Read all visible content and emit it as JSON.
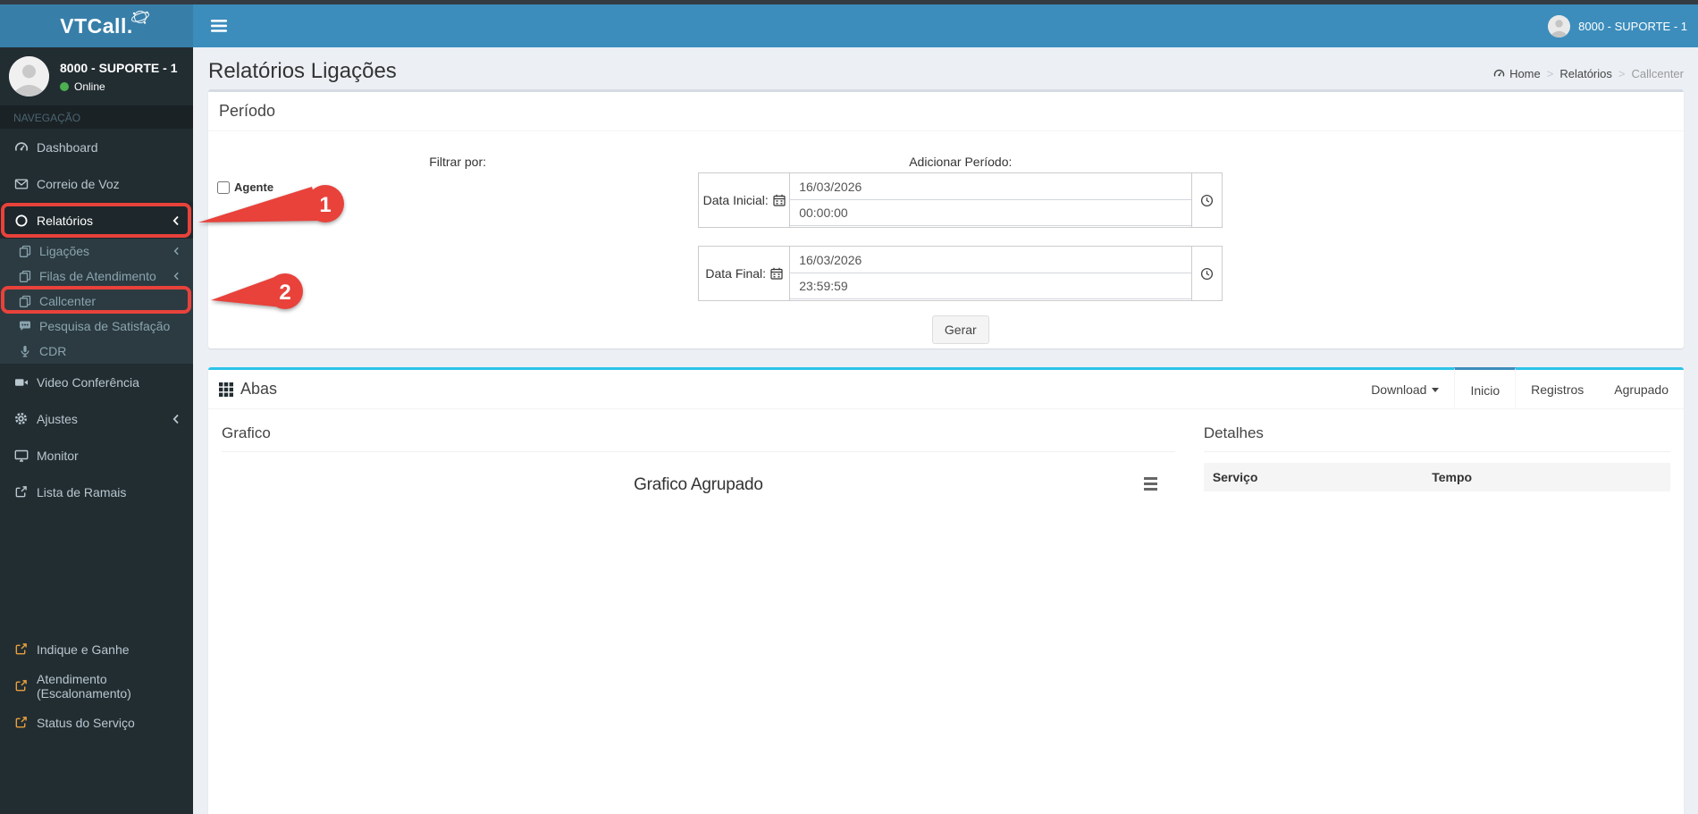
{
  "header": {
    "logo": "VTCall.",
    "user_name": "8000 - SUPORTE - 1"
  },
  "sidebar": {
    "user": {
      "name": "8000 - SUPORTE - 1",
      "status": "Online"
    },
    "nav_header": "NAVEGAÇÃO",
    "menu": [
      {
        "label": "Dashboard",
        "icon": "gauge-icon"
      },
      {
        "label": "Correio de Voz",
        "icon": "envelope-icon"
      },
      {
        "label": "Relatórios",
        "icon": "circle-icon",
        "active": true,
        "chevron": true
      }
    ],
    "submenu": [
      {
        "label": "Ligações",
        "icon": "files-icon",
        "chevron": true
      },
      {
        "label": "Filas de Atendimento",
        "icon": "files-icon",
        "chevron": true
      },
      {
        "label": "Callcenter",
        "icon": "files-icon"
      },
      {
        "label": "Pesquisa de Satisfação",
        "icon": "survey-icon"
      },
      {
        "label": "CDR",
        "icon": "microphone-icon"
      }
    ],
    "menu2": [
      {
        "label": "Video Conferência",
        "icon": "video-icon"
      },
      {
        "label": "Ajustes",
        "icon": "gear-icon",
        "chevron": true
      },
      {
        "label": "Monitor",
        "icon": "monitor-icon"
      },
      {
        "label": "Lista de Ramais",
        "icon": "external-link-icon"
      }
    ],
    "external_links": [
      {
        "label": "Indique e Ganhe",
        "icon": "external-link-icon"
      },
      {
        "label": "Atendimento (Escalonamento)",
        "icon": "external-link-icon"
      },
      {
        "label": "Status do Serviço",
        "icon": "external-link-icon"
      }
    ]
  },
  "page": {
    "title": "Relatórios Ligações",
    "breadcrumb": {
      "home": "Home",
      "section": "Relatórios",
      "current": "Callcenter"
    }
  },
  "period_panel": {
    "title": "Período",
    "filter_label": "Filtrar por:",
    "agent_label": "Agente",
    "agent_checked": false,
    "add_period_label": "Adicionar Período:",
    "date_initial": {
      "label": "Data Inicial:",
      "date": "16/03/2026",
      "time": "00:00:00"
    },
    "date_final": {
      "label": "Data Final:",
      "date": "16/03/2026",
      "time": "23:59:59"
    },
    "generate_label": "Gerar"
  },
  "tabs_panel": {
    "title": "Abas",
    "download_label": "Download",
    "tabs": [
      {
        "label": "Inicio",
        "active": true
      },
      {
        "label": "Registros",
        "active": false
      },
      {
        "label": "Agrupado",
        "active": false
      }
    ]
  },
  "grafico": {
    "section_title": "Grafico",
    "chart_title": "Grafico Agrupado"
  },
  "detalhes": {
    "section_title": "Detalhes",
    "columns": [
      "Serviço",
      "Tempo"
    ]
  },
  "annotations": [
    {
      "number": "1"
    },
    {
      "number": "2"
    }
  ],
  "colors": {
    "header_blue": "#3c8dbc",
    "logo_blue": "#377fa9",
    "sidebar_dark": "#222d32",
    "submenu_dark": "#2c3b41",
    "info_cyan": "#2cc3e8",
    "annotation_red": "#e8423b",
    "online_green": "#4caf50",
    "external_orange": "#e9a03b",
    "content_bg": "#ecf0f5"
  }
}
